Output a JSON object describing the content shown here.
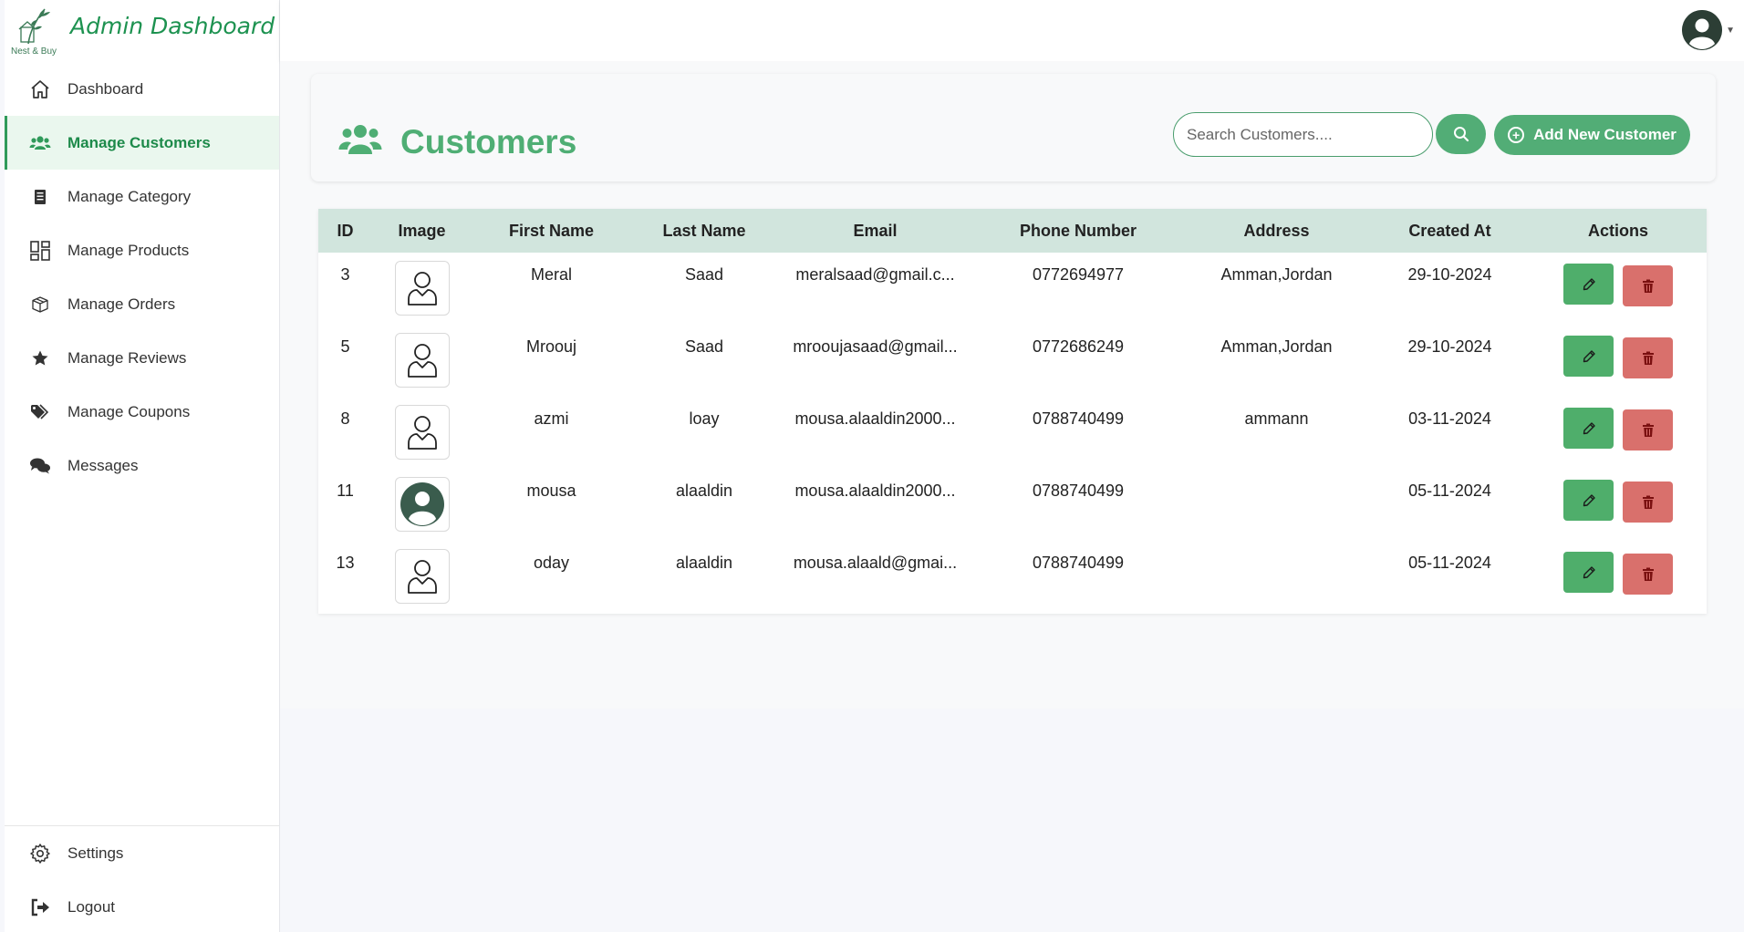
{
  "brand": {
    "title": "Admin Dashboard",
    "logo_text": "Nest & Buy"
  },
  "sidebar": {
    "items": [
      {
        "label": "Dashboard",
        "icon": "home-icon",
        "active": false
      },
      {
        "label": "Manage Customers",
        "icon": "users-icon",
        "active": true
      },
      {
        "label": "Manage Category",
        "icon": "list-icon",
        "active": false
      },
      {
        "label": "Manage Products",
        "icon": "grid-icon",
        "active": false
      },
      {
        "label": "Manage Orders",
        "icon": "box-icon",
        "active": false
      },
      {
        "label": "Manage Reviews",
        "icon": "star-icon",
        "active": false
      },
      {
        "label": "Manage Coupons",
        "icon": "tags-icon",
        "active": false
      },
      {
        "label": "Messages",
        "icon": "chat-icon",
        "active": false
      }
    ],
    "bottom": [
      {
        "label": "Settings",
        "icon": "gear-icon"
      },
      {
        "label": "Logout",
        "icon": "logout-icon"
      }
    ]
  },
  "page": {
    "title": "Customers",
    "search_placeholder": "Search Customers....",
    "add_button": "Add New Customer"
  },
  "table": {
    "headers": [
      "ID",
      "Image",
      "First Name",
      "Last Name",
      "Email",
      "Phone Number",
      "Address",
      "Created At",
      "Actions"
    ],
    "rows": [
      {
        "id": "3",
        "image": "placeholder-user",
        "first": "Meral",
        "last": "Saad",
        "email": "meralsaad@gmail.c...",
        "phone": "0772694977",
        "address": "Amman,Jordan",
        "created": "29-10-2024"
      },
      {
        "id": "5",
        "image": "placeholder-user",
        "first": "Mroouj",
        "last": "Saad",
        "email": "mroouj​asaad@gmail...",
        "phone": "0772686249",
        "address": "Amman,Jordan",
        "created": "29-10-2024"
      },
      {
        "id": "8",
        "image": "placeholder-user",
        "first": "azmi",
        "last": "loay",
        "email": "mousa.alaaldin2000...",
        "phone": "0788740499",
        "address": "ammann",
        "created": "03-11-2024"
      },
      {
        "id": "11",
        "image": "filled-avatar",
        "first": "mousa",
        "last": "alaaldin",
        "email": "mousa.alaaldin2000...",
        "phone": "0788740499",
        "address": "",
        "created": "05-11-2024"
      },
      {
        "id": "13",
        "image": "placeholder-user",
        "first": "oday",
        "last": "alaaldin",
        "email": "mousa.alaald@gmai...",
        "phone": "0788740499",
        "address": "",
        "created": "05-11-2024"
      }
    ]
  },
  "colors": {
    "accent": "#52ad76",
    "active_text": "#1d8a4a",
    "header_row": "#d1e5dd",
    "delete": "#d9706c"
  }
}
